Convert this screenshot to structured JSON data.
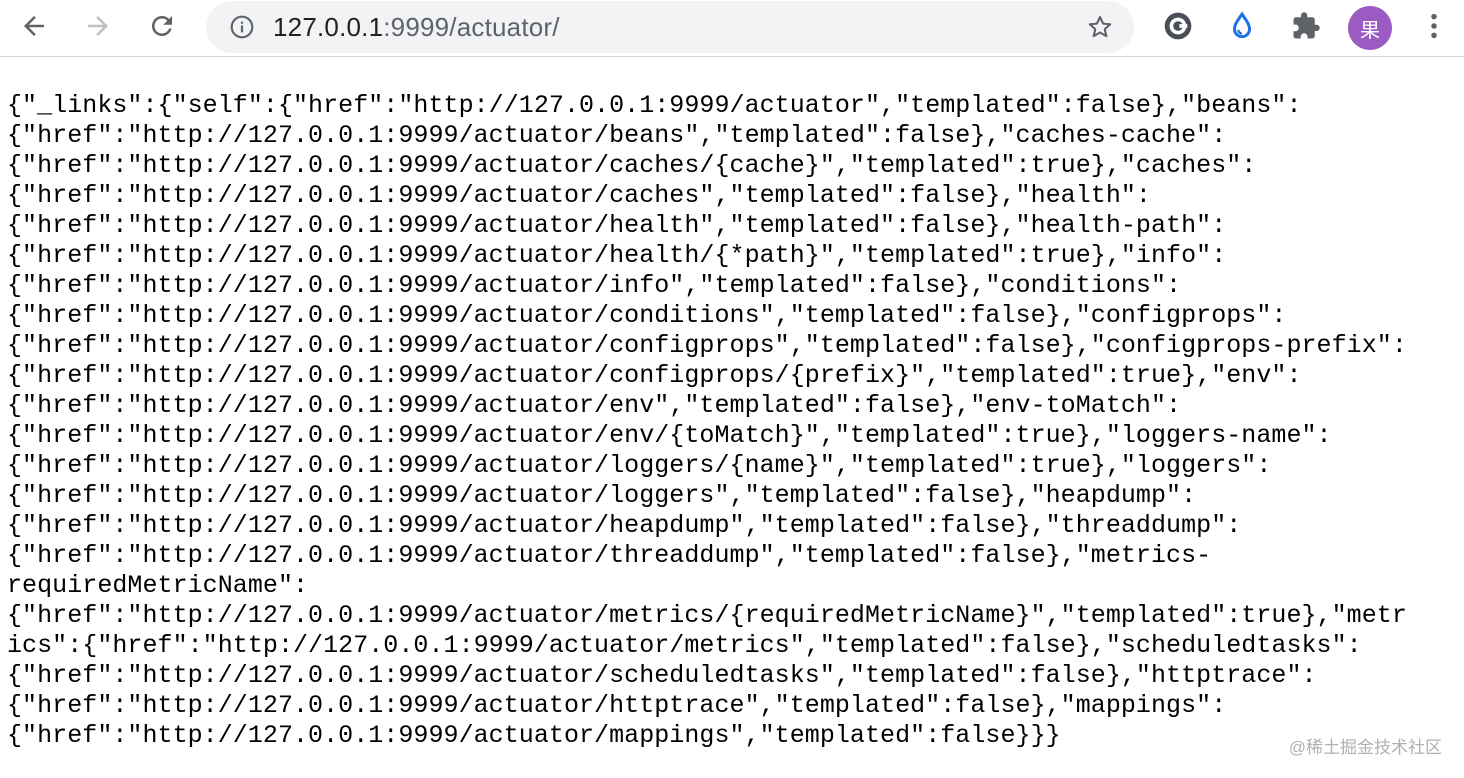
{
  "browser": {
    "url_host": "127.0.0.1",
    "url_rest": ":9999/actuator/",
    "profile_initial": "果",
    "icons": {
      "back": "back-arrow-icon",
      "forward": "forward-arrow-icon",
      "reload": "reload-icon",
      "site_info": "info-icon",
      "bookmark": "star-icon",
      "ext1": "cloud-circle-extension-icon",
      "ext2": "water-drop-extension-icon",
      "ext3": "puzzle-extensions-icon",
      "menu": "kebab-menu-icon"
    }
  },
  "page": {
    "lines": [
      "{\"_links\":{\"self\":{\"href\":\"http://127.0.0.1:9999/actuator\",\"templated\":false},\"beans\":",
      "{\"href\":\"http://127.0.0.1:9999/actuator/beans\",\"templated\":false},\"caches-cache\":",
      "{\"href\":\"http://127.0.0.1:9999/actuator/caches/{cache}\",\"templated\":true},\"caches\":",
      "{\"href\":\"http://127.0.0.1:9999/actuator/caches\",\"templated\":false},\"health\":",
      "{\"href\":\"http://127.0.0.1:9999/actuator/health\",\"templated\":false},\"health-path\":",
      "{\"href\":\"http://127.0.0.1:9999/actuator/health/{*path}\",\"templated\":true},\"info\":",
      "{\"href\":\"http://127.0.0.1:9999/actuator/info\",\"templated\":false},\"conditions\":",
      "{\"href\":\"http://127.0.0.1:9999/actuator/conditions\",\"templated\":false},\"configprops\":",
      "{\"href\":\"http://127.0.0.1:9999/actuator/configprops\",\"templated\":false},\"configprops-prefix\":",
      "{\"href\":\"http://127.0.0.1:9999/actuator/configprops/{prefix}\",\"templated\":true},\"env\":",
      "{\"href\":\"http://127.0.0.1:9999/actuator/env\",\"templated\":false},\"env-toMatch\":",
      "{\"href\":\"http://127.0.0.1:9999/actuator/env/{toMatch}\",\"templated\":true},\"loggers-name\":",
      "{\"href\":\"http://127.0.0.1:9999/actuator/loggers/{name}\",\"templated\":true},\"loggers\":",
      "{\"href\":\"http://127.0.0.1:9999/actuator/loggers\",\"templated\":false},\"heapdump\":",
      "{\"href\":\"http://127.0.0.1:9999/actuator/heapdump\",\"templated\":false},\"threaddump\":",
      "{\"href\":\"http://127.0.0.1:9999/actuator/threaddump\",\"templated\":false},\"metrics-",
      "requiredMetricName\":",
      "{\"href\":\"http://127.0.0.1:9999/actuator/metrics/{requiredMetricName}\",\"templated\":true},\"metr",
      "ics\":{\"href\":\"http://127.0.0.1:9999/actuator/metrics\",\"templated\":false},\"scheduledtasks\":",
      "{\"href\":\"http://127.0.0.1:9999/actuator/scheduledtasks\",\"templated\":false},\"httptrace\":",
      "{\"href\":\"http://127.0.0.1:9999/actuator/httptrace\",\"templated\":false},\"mappings\":",
      "{\"href\":\"http://127.0.0.1:9999/actuator/mappings\",\"templated\":false}}}"
    ],
    "watermark": "@稀土掘金技术社区"
  }
}
